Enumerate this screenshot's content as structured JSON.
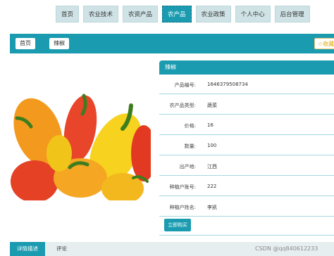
{
  "nav": {
    "items": [
      {
        "label": "首页"
      },
      {
        "label": "农业技术"
      },
      {
        "label": "农资产品"
      },
      {
        "label": "农产品"
      },
      {
        "label": "农业政策"
      },
      {
        "label": "个人中心"
      },
      {
        "label": "后台管理"
      }
    ],
    "active_index": 3
  },
  "breadcrumb": {
    "home": "首页",
    "current": "辣椒",
    "favorite": "☆收藏"
  },
  "product": {
    "image": "peppers-photo",
    "title": "辣椒",
    "fields": [
      {
        "label": "产品编号:",
        "value": "1646379508734"
      },
      {
        "label": "农产品类型:",
        "value": "蔬菜"
      },
      {
        "label": "价格:",
        "value": "16"
      },
      {
        "label": "数量:",
        "value": "100"
      },
      {
        "label": "出产地:",
        "value": "江西"
      },
      {
        "label": "种植户账号:",
        "value": "222"
      },
      {
        "label": "种植户姓名:",
        "value": "李凯"
      }
    ],
    "buy_label": "立即购买"
  },
  "tabs": [
    {
      "label": "详情描述"
    },
    {
      "label": "评论"
    }
  ],
  "watermark": "CSDN @qq840612233",
  "colors": {
    "accent": "#1b9bb0",
    "nav_bg": "#cfe3e6"
  }
}
